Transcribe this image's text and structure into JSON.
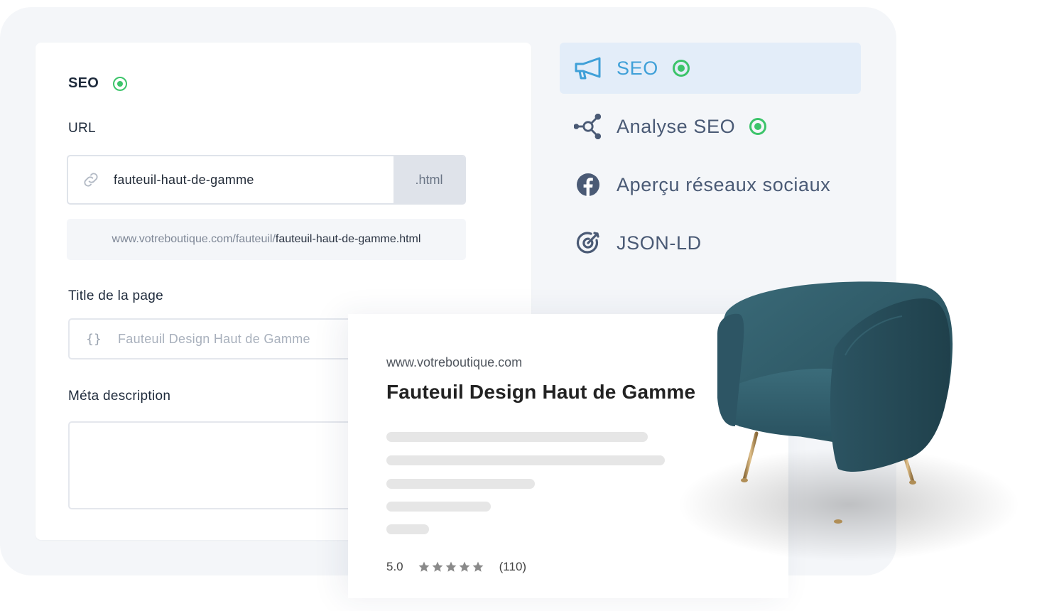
{
  "form": {
    "section_title": "SEO",
    "url_label": "URL",
    "url_value": "fauteuil-haut-de-gamme",
    "url_suffix": ".html",
    "url_preview_base": "www.votreboutique.com/fauteuil/",
    "url_preview_slug": "fauteuil-haut-de-gamme.html",
    "title_label": "Title de la page",
    "title_placeholder": "Fauteuil Design Haut de Gamme",
    "meta_label": "Méta description"
  },
  "menu": {
    "items": [
      {
        "label": "SEO",
        "icon": "megaphone-icon",
        "active": true,
        "status": "ok"
      },
      {
        "label": "Analyse SEO",
        "icon": "network-icon",
        "active": false,
        "status": "ok"
      },
      {
        "label": "Aperçu réseaux sociaux",
        "icon": "facebook-icon",
        "active": false
      },
      {
        "label": "JSON-LD",
        "icon": "target-icon",
        "active": false
      }
    ]
  },
  "preview": {
    "domain": "www.votreboutique.com",
    "title": "Fauteuil Design Haut de Gamme",
    "rating_value": "5.0",
    "rating_stars": 5,
    "review_count": "(110)"
  },
  "colors": {
    "accent": "#3fa0d8",
    "status_ok": "#3cc46a",
    "menu_text": "#4a5a75",
    "active_bg": "#e3edf9",
    "chair": "#2f5865"
  }
}
